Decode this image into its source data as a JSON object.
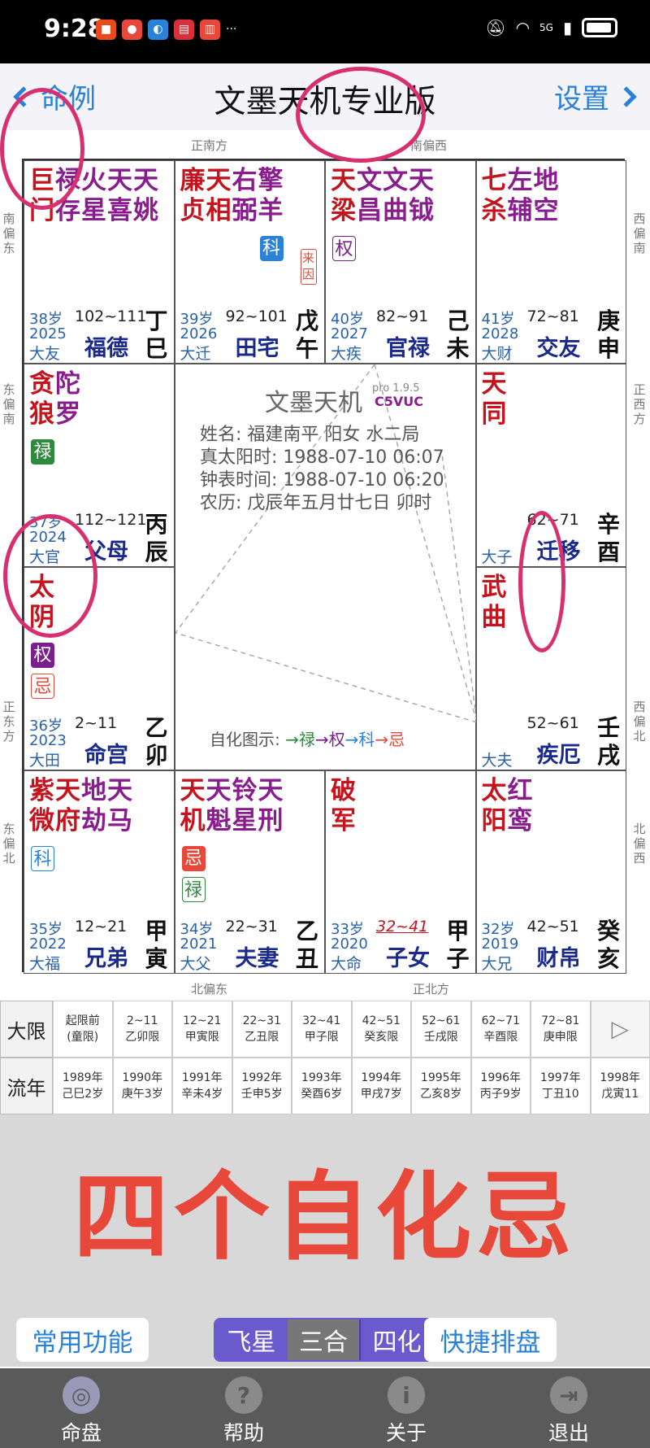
{
  "status_bar": {
    "time": "9:28",
    "more": "···",
    "network": "5G"
  },
  "header": {
    "back_label": "命例",
    "title": "文墨天机专业版",
    "settings_label": "设置"
  },
  "directions": {
    "top_left": "正南方",
    "top_right": "南偏西",
    "left_1": "南偏东",
    "left_2": "东偏南",
    "left_3": "正东方",
    "left_4": "东偏北",
    "right_1": "西偏南",
    "right_2": "正西方",
    "right_3": "西偏北",
    "right_4": "北偏西",
    "bottom_left": "北偏东",
    "bottom_right": "正北方"
  },
  "palaces": [
    {
      "id": "si",
      "cols": [
        [
          "巨",
          "门"
        ],
        [
          "禄",
          "存"
        ],
        [
          "火",
          "星"
        ],
        [
          "天",
          "喜"
        ],
        [
          "天",
          "姚"
        ]
      ],
      "main_count": 1,
      "age": "38岁",
      "year": "2025",
      "daxian": "大友",
      "range": "102~111",
      "name": "福德",
      "gz": [
        "丁",
        "巳"
      ]
    },
    {
      "id": "wu",
      "cols": [
        [
          "廉",
          "贞"
        ],
        [
          "天",
          "相"
        ],
        [
          "右",
          "弼"
        ],
        [
          "擎",
          "羊"
        ]
      ],
      "main_count": 2,
      "age": "39岁",
      "year": "2026",
      "daxian": "大迁",
      "range": "92~101",
      "name": "田宅",
      "gz": [
        "戊",
        "午"
      ],
      "hua": [
        {
          "t": "科",
          "k": "ke",
          "col": 3
        }
      ],
      "laiyin": "来因"
    },
    {
      "id": "wei",
      "cols": [
        [
          "天",
          "梁"
        ],
        [
          "文",
          "昌"
        ],
        [
          "文",
          "曲"
        ],
        [
          "天",
          "钺"
        ]
      ],
      "main_count": 1,
      "age": "40岁",
      "year": "2027",
      "daxian": "大疾",
      "range": "82~91",
      "name": "官禄",
      "gz": [
        "己",
        "未"
      ],
      "hua": [
        {
          "t": "权",
          "k": "outline-quan",
          "col": 0
        }
      ]
    },
    {
      "id": "shen",
      "cols": [
        [
          "七",
          "杀"
        ],
        [
          "左",
          "辅"
        ],
        [
          "地",
          "空"
        ]
      ],
      "main_count": 1,
      "age": "41岁",
      "year": "2028",
      "daxian": "大财",
      "range": "72~81",
      "name": "交友",
      "gz": [
        "庚",
        "申"
      ]
    },
    {
      "id": "chen",
      "cols": [
        [
          "贪",
          "狼"
        ],
        [
          "陀",
          "罗"
        ]
      ],
      "main_count": 1,
      "age": "37岁",
      "year": "2024",
      "daxian": "大官",
      "range": "112~121",
      "name": "父母",
      "gz": [
        "丙",
        "辰"
      ],
      "hua": [
        {
          "t": "禄",
          "k": "lu",
          "col": 0
        }
      ]
    },
    {
      "id": "you",
      "cols": [
        [
          "天",
          "同"
        ]
      ],
      "main_count": 1,
      "age": "",
      "year": "",
      "daxian": "大子",
      "range": "62~71",
      "name": "迁移",
      "gz": [
        "辛",
        "酉"
      ]
    },
    {
      "id": "mao",
      "cols": [
        [
          "太",
          "阴"
        ]
      ],
      "main_count": 1,
      "age": "36岁",
      "year": "2023",
      "daxian": "大田",
      "range": "2~11",
      "name": "命宫",
      "gz": [
        "乙",
        "卯"
      ],
      "hua": [
        {
          "t": "权",
          "k": "quan",
          "col": 0
        },
        {
          "t": "忌",
          "k": "outline-ji",
          "col": 0
        }
      ]
    },
    {
      "id": "xu",
      "cols": [
        [
          "武",
          "曲"
        ]
      ],
      "main_count": 1,
      "age": "",
      "year": "",
      "daxian": "大夫",
      "range": "52~61",
      "name": "疾厄",
      "gz": [
        "壬",
        "戌"
      ]
    },
    {
      "id": "yin",
      "cols": [
        [
          "紫",
          "微"
        ],
        [
          "天",
          "府"
        ],
        [
          "地",
          "劫"
        ],
        [
          "天",
          "马"
        ]
      ],
      "main_count": 2,
      "age": "35岁",
      "year": "2022",
      "daxian": "大福",
      "range": "12~21",
      "name": "兄弟",
      "gz": [
        "甲",
        "寅"
      ],
      "hua": [
        {
          "t": "科",
          "k": "outline-ke",
          "col": 0
        }
      ]
    },
    {
      "id": "chou",
      "cols": [
        [
          "天",
          "机"
        ],
        [
          "天",
          "魁"
        ],
        [
          "铃",
          "星"
        ],
        [
          "天",
          "刑"
        ]
      ],
      "main_count": 1,
      "age": "34岁",
      "year": "2021",
      "daxian": "大父",
      "range": "22~31",
      "name": "夫妻",
      "gz": [
        "乙",
        "丑"
      ],
      "hua": [
        {
          "t": "忌",
          "k": "ji",
          "col": 0
        },
        {
          "t": "禄",
          "k": "outline-lu",
          "col": 0
        }
      ]
    },
    {
      "id": "zi",
      "cols": [
        [
          "破",
          "军"
        ]
      ],
      "main_count": 1,
      "age": "33岁",
      "year": "2020",
      "daxian": "大命",
      "range": "32~41",
      "name": "子女",
      "gz": [
        "甲",
        "子"
      ],
      "range_red": true
    },
    {
      "id": "hai",
      "cols": [
        [
          "太",
          "阳"
        ],
        [
          "红",
          "鸾"
        ]
      ],
      "main_count": 1,
      "age": "32岁",
      "year": "2019",
      "daxian": "大兄",
      "range": "42~51",
      "name": "财帛",
      "gz": [
        "癸",
        "亥"
      ]
    }
  ],
  "center": {
    "brand": "文墨天机",
    "version": "pro 1.9.5",
    "code": "C5VUC",
    "name_line": "姓名: 福建南平    阳女 水二局",
    "solar_line": "真太阳时: 1988-07-10 06:07",
    "clock_line": "钟表时间: 1988-07-10 06:20",
    "lunar_line": "农历: 戊辰年五月廿七日 卯时",
    "legend_label": "自化图示:",
    "legend_lu": "→禄",
    "legend_quan": "→权",
    "legend_ke": "→科",
    "legend_ji": "→忌"
  },
  "daxian_row": {
    "label": "大限",
    "cells": [
      [
        "起限前",
        "(童限)"
      ],
      [
        "2~11",
        "乙卯限"
      ],
      [
        "12~21",
        "甲寅限"
      ],
      [
        "22~31",
        "乙丑限"
      ],
      [
        "32~41",
        "甲子限"
      ],
      [
        "42~51",
        "癸亥限"
      ],
      [
        "52~61",
        "壬戌限"
      ],
      [
        "62~71",
        "辛酉限"
      ],
      [
        "72~81",
        "庚申限"
      ]
    ],
    "next": "▷"
  },
  "liunian_row": {
    "label": "流年",
    "cells": [
      [
        "1989年",
        "己巳2岁"
      ],
      [
        "1990年",
        "庚午3岁"
      ],
      [
        "1991年",
        "辛未4岁"
      ],
      [
        "1992年",
        "壬申5岁"
      ],
      [
        "1993年",
        "癸酉6岁"
      ],
      [
        "1994年",
        "甲戌7岁"
      ],
      [
        "1995年",
        "乙亥8岁"
      ],
      [
        "1996年",
        "丙子9岁"
      ],
      [
        "1997年",
        "丁丑10"
      ],
      [
        "1998年",
        "戊寅11"
      ]
    ]
  },
  "caption": "四个自化忌",
  "actions": {
    "common": "常用功能",
    "quick": "快捷排盘",
    "seg": [
      "飞星",
      "三合",
      "四化"
    ]
  },
  "tabs": [
    {
      "label": "命盘",
      "icon": "chart-icon",
      "glyph": "◎"
    },
    {
      "label": "帮助",
      "icon": "help-icon",
      "glyph": "?"
    },
    {
      "label": "关于",
      "icon": "info-icon",
      "glyph": "i"
    },
    {
      "label": "退出",
      "icon": "exit-icon",
      "glyph": "⇥"
    }
  ],
  "colors": {
    "accent": "#2a82d8",
    "main_star": "#c4141e",
    "minor_star": "#8a1d8e",
    "annotation": "#d8306e",
    "caption": "#e8483a"
  }
}
